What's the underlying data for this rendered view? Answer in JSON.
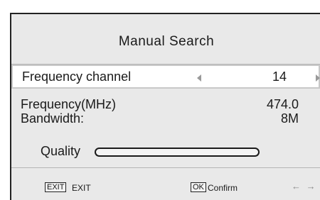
{
  "title": "Manual Search",
  "frequency_channel": {
    "label": "Frequency channel",
    "value": "14"
  },
  "frequency": {
    "label": "Frequency(MHz)",
    "value": "474.0"
  },
  "bandwidth": {
    "label": "Bandwidth:",
    "value": "8M"
  },
  "quality": {
    "label": "Quality",
    "level_fraction": 0.0
  },
  "footer": {
    "exit_key": "EXIT",
    "exit_label": "EXIT",
    "ok_key": "OK",
    "ok_label": "Confirm",
    "nav_hint": "← →"
  },
  "icons": [
    "arrow-left-icon",
    "arrow-right-icon",
    "left-right-arrows-icon"
  ]
}
